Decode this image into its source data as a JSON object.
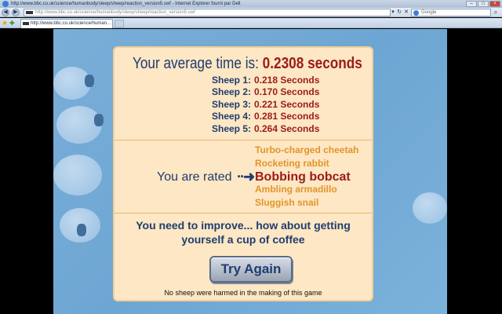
{
  "window": {
    "title": "http://www.bbc.co.uk/science/humanbody/sleep/sheep/reaction_version5.swf - Internet Explorer fourni par Dell"
  },
  "navbar": {
    "back_label": "◀",
    "forward_label": "▶",
    "address_value": "http://www.bbc.co.uk/science/humanbody/sleep/sheep/reaction_version5.swf",
    "dropdown_label": "▾",
    "refresh_label": "↻",
    "stop_label": "✕",
    "search_placeholder": "Google",
    "search_button_label": "⌕"
  },
  "tabs": [
    {
      "label": "http://www.bbc.co.uk/science/human..."
    }
  ],
  "game": {
    "average_label": "Your average time is:",
    "average_value": "0.2308 seconds",
    "sheep_times": [
      {
        "label": "Sheep 1:",
        "value": "0.218 Seconds"
      },
      {
        "label": "Sheep 2:",
        "value": "0.170 Seconds"
      },
      {
        "label": "Sheep 3:",
        "value": "0.221 Seconds"
      },
      {
        "label": "Sheep 4:",
        "value": "0.281 Seconds"
      },
      {
        "label": "Sheep 5:",
        "value": "0.264 Seconds"
      }
    ],
    "rated_label": "You are rated",
    "rated_arrow": "··➜",
    "ratings": [
      "Turbo-charged cheetah",
      "Rocketing rabbit",
      "Bobbing bobcat",
      "Ambling armadillo",
      "Sluggish snail"
    ],
    "current_rating_index": 2,
    "improve_message": "You need to improve... how about getting yourself a cup of coffee",
    "try_again_label": "Try Again",
    "disclaimer": "No sheep were harmed in the making of this game"
  },
  "colors": {
    "title_blue": "#1f3d6e",
    "value_red": "#9b1c16",
    "rating_orange": "#e2952b",
    "panel_bg": "#fde7c4",
    "stage_blue": "#6ea6d3"
  }
}
